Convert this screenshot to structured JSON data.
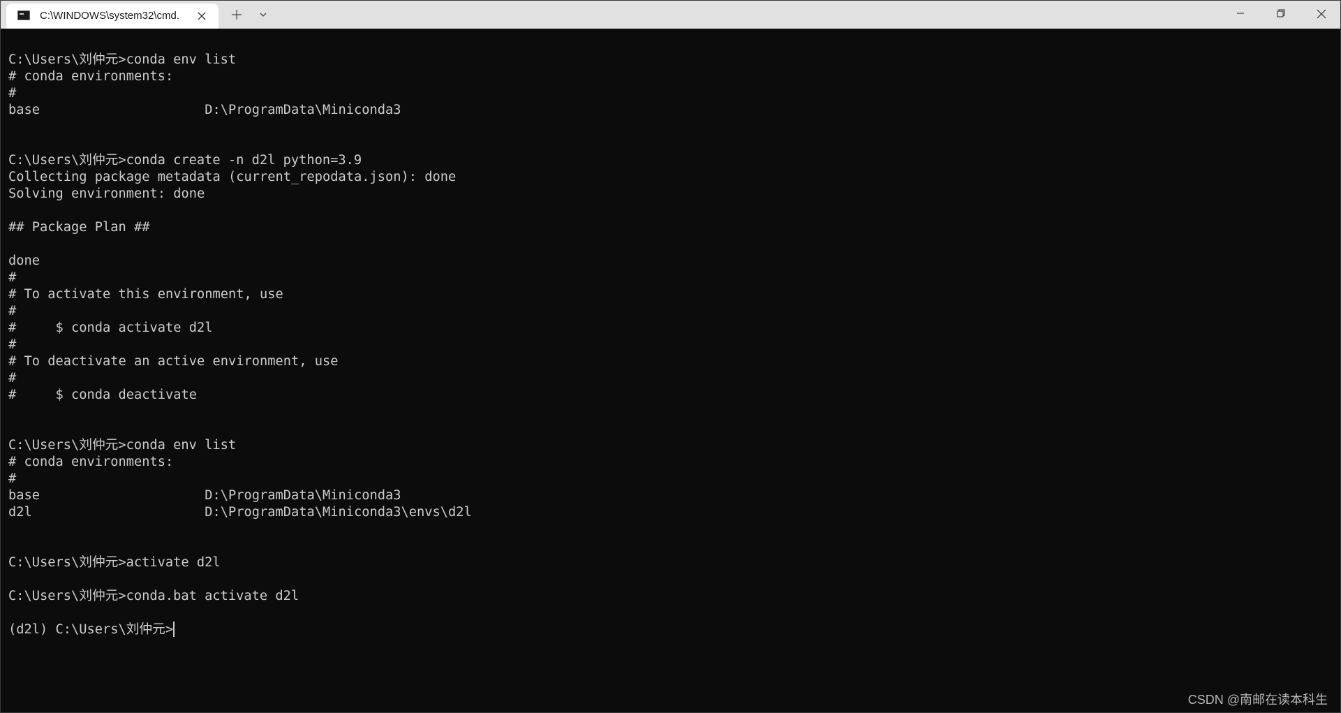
{
  "tab": {
    "title": "C:\\WINDOWS\\system32\\cmd.",
    "icon": "terminal-icon"
  },
  "toolbar": {
    "new_tab_icon": "plus-icon",
    "dropdown_icon": "chevron-down-icon"
  },
  "window_controls": [
    "minimize-icon",
    "maximize-icon",
    "close-icon"
  ],
  "terminal": {
    "lines": [
      "C:\\Users\\刘仲元>conda env list",
      "# conda environments:",
      "#",
      "base                     D:\\ProgramData\\Miniconda3",
      "",
      "",
      "C:\\Users\\刘仲元>conda create -n d2l python=3.9",
      "Collecting package metadata (current_repodata.json): done",
      "Solving environment: done",
      "",
      "## Package Plan ##",
      "",
      "done",
      "#",
      "# To activate this environment, use",
      "#",
      "#     $ conda activate d2l",
      "#",
      "# To deactivate an active environment, use",
      "#",
      "#     $ conda deactivate",
      "",
      "",
      "C:\\Users\\刘仲元>conda env list",
      "# conda environments:",
      "#",
      "base                     D:\\ProgramData\\Miniconda3",
      "d2l                      D:\\ProgramData\\Miniconda3\\envs\\d2l",
      "",
      "",
      "C:\\Users\\刘仲元>activate d2l",
      "",
      "C:\\Users\\刘仲元>conda.bat activate d2l",
      "",
      "(d2l) C:\\Users\\刘仲元>"
    ]
  },
  "watermark": "CSDN @南邮在读本科生",
  "colors": {
    "background": "#0c0c0c",
    "foreground": "#cccccc",
    "titlebar": "#e1e1e1",
    "tab_active": "#ffffff"
  }
}
